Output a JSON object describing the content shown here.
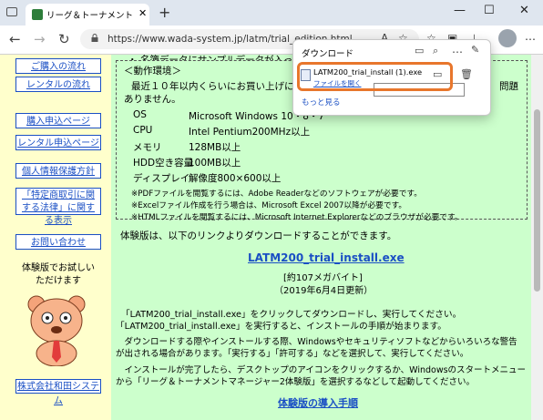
{
  "browser": {
    "tab_title": "リーグ＆トーナメントマネージャー 体験版",
    "tab_close": "✕",
    "new_tab": "+",
    "url": "https://www.wada-system.jp/latm/trial_edition.html",
    "win_min": "—",
    "win_max": "☐",
    "win_close": "✕",
    "back": "←",
    "forward": "→",
    "refresh": "↻",
    "more": "…"
  },
  "sidebar": {
    "links": [
      "ご購入の流れ",
      "レンタルの流れ",
      "購入申込ページ",
      "レンタル申込ページ",
      "個人情報保護方針",
      "「特定商取引に関する法律」に関する表示",
      "お問い合わせ"
    ],
    "trial_caption": "体験版でお試しいただけます",
    "company": "株式会社和田システム"
  },
  "main": {
    "top_partial": "・ 名簿データにサンプルデータが入って…",
    "env_heading": "＜動作環境＞",
    "env_intro": "最近１０年以内くらいにお買い上げにな",
    "env_intro_suffix": "問題",
    "env_intro2": "ありません。",
    "specs": [
      {
        "k": "OS",
        "v": "Microsoft Windows 10・8・7"
      },
      {
        "k": "CPU",
        "v": "Intel Pentium200MHz以上"
      },
      {
        "k": "メモリ",
        "v": "128MB以上"
      },
      {
        "k": "HDD空き容量",
        "v": "100MB以上"
      },
      {
        "k": "ディスプレイ",
        "v": "解像度800×600以上"
      }
    ],
    "notes": [
      "※PDFファイルを閲覧するには、Adobe Readerなどのソフトウェアが必要です。",
      "※Excelファイル作成を行う場合は、Microsoft Excel 2007以降が必要です。",
      "※HTMLファイルを閲覧するには、Microsoft Internet Explorerなどのブラウザが必要です。"
    ],
    "download_intro": "体験版は、以下のリンクよりダウンロードすることができます。",
    "download_link": "LATM200_trial_install.exe",
    "size": "[約107メガバイト]",
    "date": "（2019年6月4日更新）",
    "para1": [
      "「LATM200_trial_install.exe」をクリックしてダウンロードし、実行してください。",
      "「LATM200_trial_install.exe」を実行すると、インストールの手順が始まります。"
    ],
    "para2": [
      "　ダウンロードする際やインストールする際、Windowsやセキュリティソフトなどからいろいろな警告",
      "が出される場合があります。「実行する」「許可する」などを選択して、実行してください。"
    ],
    "para3": [
      "　インストールが完了したら、デスクトップのアイコンをクリックするか、Windowsのスタートメニュー",
      "から「リーグ＆トーナメントマネージャー2体験版」を選択するなどして起動してください。"
    ],
    "steps_heading": "体験版の導入手順"
  },
  "downloads": {
    "title": "ダウンロード",
    "filename": "LATM200_trial_install (1).exe",
    "open_file": "ファイルを開く",
    "more": "もっと見る"
  },
  "colors": {
    "accent": "#e8762c",
    "link": "#1a4fc4",
    "sidebar_bg": "#ffffcc",
    "main_bg": "#ccffcc"
  }
}
